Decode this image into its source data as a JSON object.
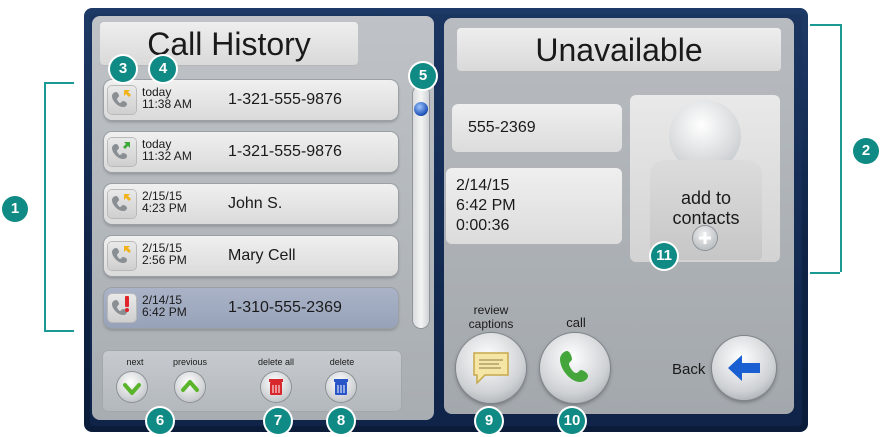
{
  "left": {
    "title": "Call History",
    "rows": [
      {
        "date": "today",
        "time": "11:38 AM",
        "label": "1-321-555-9876",
        "status": "missed"
      },
      {
        "date": "today",
        "time": "11:32 AM",
        "label": "1-321-555-9876",
        "status": "outgoing"
      },
      {
        "date": "2/15/15",
        "time": "4:23 PM",
        "label": "John S.",
        "status": "missed"
      },
      {
        "date": "2/15/15",
        "time": "2:56 PM",
        "label": "Mary Cell",
        "status": "missed"
      },
      {
        "date": "2/14/15",
        "time": "6:42 PM",
        "label": "1-310-555-2369",
        "status": "unavailable",
        "selected": true
      }
    ],
    "toolbar": {
      "next": "next",
      "previous": "previous",
      "delete_all": "delete all",
      "delete": "delete"
    }
  },
  "right": {
    "title": "Unavailable",
    "number": "555-2369",
    "details": {
      "date": "2/14/15",
      "time": "6:42 PM",
      "duration": "0:00:36"
    },
    "add_contact_line1": "add to",
    "add_contact_line2": "contacts",
    "review_captions_line1": "review",
    "review_captions_line2": "captions",
    "call": "call",
    "back": "Back"
  },
  "callouts": [
    "1",
    "2",
    "3",
    "4",
    "5",
    "6",
    "7",
    "8",
    "9",
    "10",
    "11"
  ],
  "colors": {
    "callout": "#0f8a84",
    "frame": "#102a52",
    "accent_blue": "#1a5fd1",
    "missed_arrow": "#f2b21c",
    "outgoing_arrow": "#3fa83b",
    "unavailable_mark": "#e0242b"
  },
  "icons": {
    "row_icon": "phone-icon",
    "next": "checkmark-icon",
    "previous": "chevron-up-icon",
    "delete_all": "trash-icon",
    "delete": "trash-icon",
    "review_captions": "captions-icon",
    "call": "phone-icon",
    "back": "arrow-left-icon",
    "add_contact": "plus-icon"
  }
}
